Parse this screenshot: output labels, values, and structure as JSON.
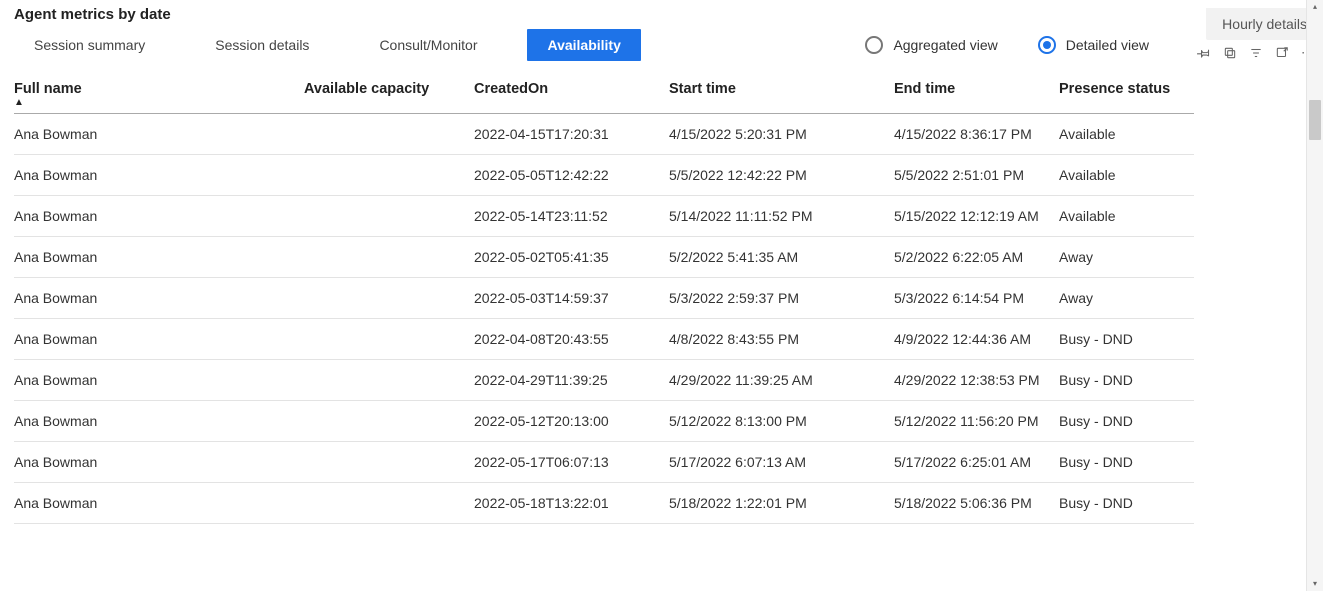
{
  "title": "Agent metrics by date",
  "tabs": [
    {
      "label": "Session summary",
      "active": false
    },
    {
      "label": "Session details",
      "active": false
    },
    {
      "label": "Consult/Monitor",
      "active": false
    },
    {
      "label": "Availability",
      "active": true
    }
  ],
  "view_options": {
    "aggregated_label": "Aggregated view",
    "detailed_label": "Detailed view",
    "selected": "detailed"
  },
  "buttons": {
    "hourly_details": "Hourly details"
  },
  "columns": [
    {
      "key": "full_name",
      "label": "Full name",
      "sorted_asc": true
    },
    {
      "key": "avail_capacity",
      "label": "Available capacity"
    },
    {
      "key": "created_on",
      "label": "CreatedOn"
    },
    {
      "key": "start_time",
      "label": "Start time"
    },
    {
      "key": "end_time",
      "label": "End time"
    },
    {
      "key": "presence",
      "label": "Presence status"
    }
  ],
  "rows": [
    {
      "full_name": "Ana Bowman",
      "avail_capacity": "",
      "created_on": "2022-04-15T17:20:31",
      "start_time": "4/15/2022 5:20:31 PM",
      "end_time": "4/15/2022 8:36:17 PM",
      "presence": "Available"
    },
    {
      "full_name": "Ana Bowman",
      "avail_capacity": "",
      "created_on": "2022-05-05T12:42:22",
      "start_time": "5/5/2022 12:42:22 PM",
      "end_time": "5/5/2022 2:51:01 PM",
      "presence": "Available"
    },
    {
      "full_name": "Ana Bowman",
      "avail_capacity": "",
      "created_on": "2022-05-14T23:11:52",
      "start_time": "5/14/2022 11:11:52 PM",
      "end_time": "5/15/2022 12:12:19 AM",
      "presence": "Available"
    },
    {
      "full_name": "Ana Bowman",
      "avail_capacity": "",
      "created_on": "2022-05-02T05:41:35",
      "start_time": "5/2/2022 5:41:35 AM",
      "end_time": "5/2/2022 6:22:05 AM",
      "presence": "Away"
    },
    {
      "full_name": "Ana Bowman",
      "avail_capacity": "",
      "created_on": "2022-05-03T14:59:37",
      "start_time": "5/3/2022 2:59:37 PM",
      "end_time": "5/3/2022 6:14:54 PM",
      "presence": "Away"
    },
    {
      "full_name": "Ana Bowman",
      "avail_capacity": "",
      "created_on": "2022-04-08T20:43:55",
      "start_time": "4/8/2022 8:43:55 PM",
      "end_time": "4/9/2022 12:44:36 AM",
      "presence": "Busy - DND"
    },
    {
      "full_name": "Ana Bowman",
      "avail_capacity": "",
      "created_on": "2022-04-29T11:39:25",
      "start_time": "4/29/2022 11:39:25 AM",
      "end_time": "4/29/2022 12:38:53 PM",
      "presence": "Busy - DND"
    },
    {
      "full_name": "Ana Bowman",
      "avail_capacity": "",
      "created_on": "2022-05-12T20:13:00",
      "start_time": "5/12/2022 8:13:00 PM",
      "end_time": "5/12/2022 11:56:20 PM",
      "presence": "Busy - DND"
    },
    {
      "full_name": "Ana Bowman",
      "avail_capacity": "",
      "created_on": "2022-05-17T06:07:13",
      "start_time": "5/17/2022 6:07:13 AM",
      "end_time": "5/17/2022 6:25:01 AM",
      "presence": "Busy - DND"
    },
    {
      "full_name": "Ana Bowman",
      "avail_capacity": "",
      "created_on": "2022-05-18T13:22:01",
      "start_time": "5/18/2022 1:22:01 PM",
      "end_time": "5/18/2022 5:06:36 PM",
      "presence": "Busy - DND"
    }
  ]
}
